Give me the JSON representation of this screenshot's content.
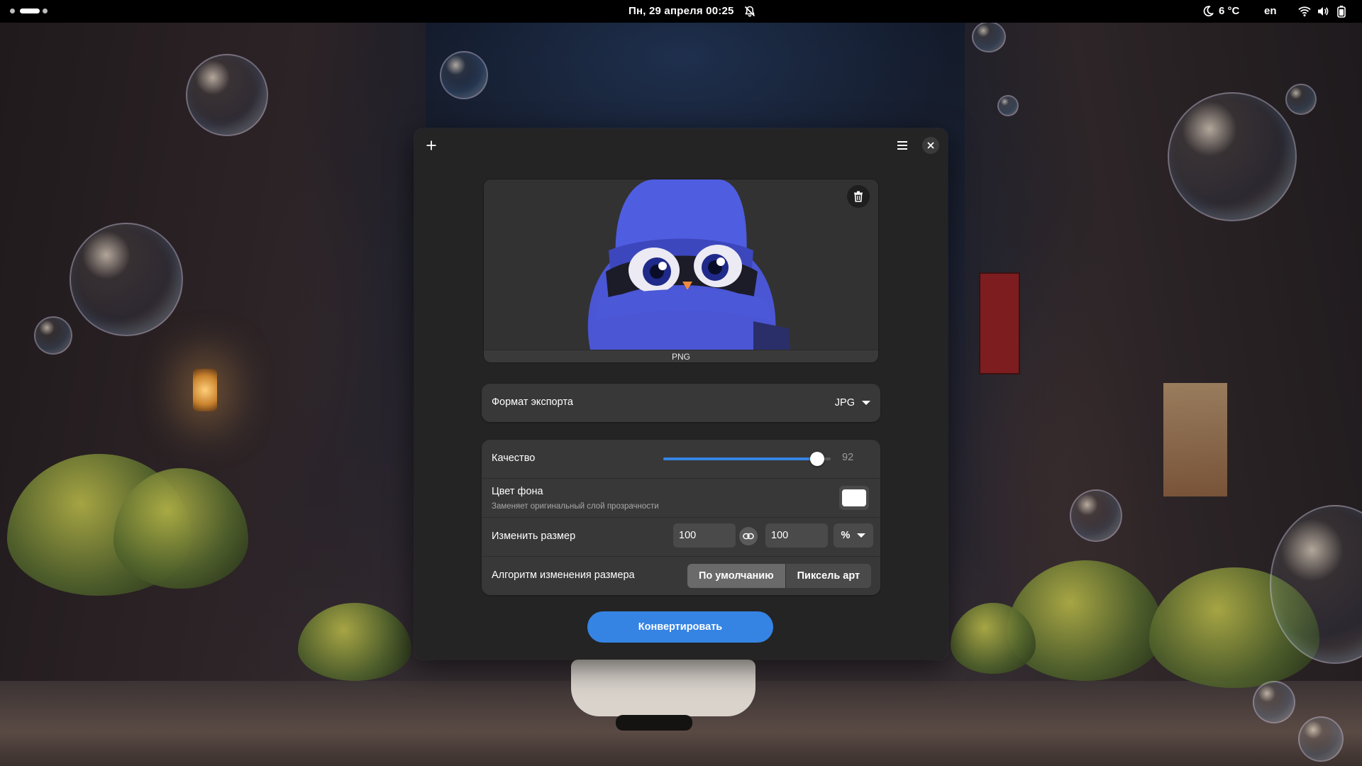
{
  "topbar": {
    "clock": "Пн, 29 апреля  00:25",
    "weather_temp": "6 °C",
    "language": "en",
    "icons": [
      "workspace-indicator",
      "notifications-off-icon",
      "weather-night-icon",
      "wifi-icon",
      "volume-icon",
      "battery-icon"
    ]
  },
  "window": {
    "headerbar": {
      "add_icon": "plus-icon",
      "menu_icon": "hamburger-menu-icon",
      "close_icon": "close-icon"
    },
    "preview": {
      "caption": "PNG",
      "delete_icon": "trash-icon"
    },
    "export_format": {
      "label": "Формат экспорта",
      "value": "JPG"
    },
    "quality": {
      "label": "Качество",
      "value": "92",
      "level": 92
    },
    "background_color": {
      "label": "Цвет фона",
      "subtitle": "Заменяет оригинальный слой прозрачности",
      "color": "#ffffff"
    },
    "resize": {
      "label": "Изменить размер",
      "width": "100",
      "height": "100",
      "unit": "%"
    },
    "algorithm": {
      "label": "Алгоритм изменения размера",
      "options": [
        "По умолчанию",
        "Пиксель арт"
      ],
      "selected": "По умолчанию"
    },
    "convert_button": "Конвертировать"
  },
  "colors": {
    "accent": "#3584e4",
    "window_bg": "#242424",
    "row_bg": "#383838"
  }
}
